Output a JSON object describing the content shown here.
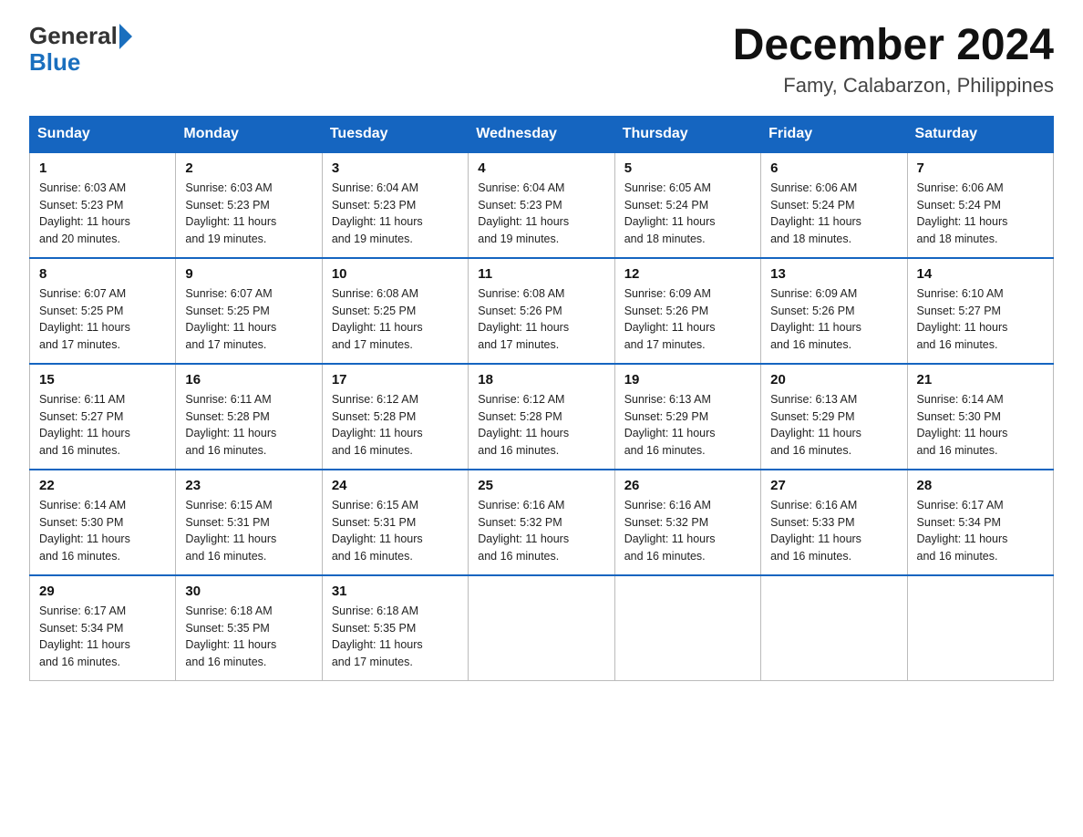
{
  "header": {
    "month": "December 2024",
    "location": "Famy, Calabarzon, Philippines",
    "logo_general": "General",
    "logo_blue": "Blue"
  },
  "weekdays": [
    "Sunday",
    "Monday",
    "Tuesday",
    "Wednesday",
    "Thursday",
    "Friday",
    "Saturday"
  ],
  "weeks": [
    {
      "days": [
        {
          "num": "1",
          "sunrise": "6:03 AM",
          "sunset": "5:23 PM",
          "daylight": "11 hours and 20 minutes."
        },
        {
          "num": "2",
          "sunrise": "6:03 AM",
          "sunset": "5:23 PM",
          "daylight": "11 hours and 19 minutes."
        },
        {
          "num": "3",
          "sunrise": "6:04 AM",
          "sunset": "5:23 PM",
          "daylight": "11 hours and 19 minutes."
        },
        {
          "num": "4",
          "sunrise": "6:04 AM",
          "sunset": "5:23 PM",
          "daylight": "11 hours and 19 minutes."
        },
        {
          "num": "5",
          "sunrise": "6:05 AM",
          "sunset": "5:24 PM",
          "daylight": "11 hours and 18 minutes."
        },
        {
          "num": "6",
          "sunrise": "6:06 AM",
          "sunset": "5:24 PM",
          "daylight": "11 hours and 18 minutes."
        },
        {
          "num": "7",
          "sunrise": "6:06 AM",
          "sunset": "5:24 PM",
          "daylight": "11 hours and 18 minutes."
        }
      ]
    },
    {
      "days": [
        {
          "num": "8",
          "sunrise": "6:07 AM",
          "sunset": "5:25 PM",
          "daylight": "11 hours and 17 minutes."
        },
        {
          "num": "9",
          "sunrise": "6:07 AM",
          "sunset": "5:25 PM",
          "daylight": "11 hours and 17 minutes."
        },
        {
          "num": "10",
          "sunrise": "6:08 AM",
          "sunset": "5:25 PM",
          "daylight": "11 hours and 17 minutes."
        },
        {
          "num": "11",
          "sunrise": "6:08 AM",
          "sunset": "5:26 PM",
          "daylight": "11 hours and 17 minutes."
        },
        {
          "num": "12",
          "sunrise": "6:09 AM",
          "sunset": "5:26 PM",
          "daylight": "11 hours and 17 minutes."
        },
        {
          "num": "13",
          "sunrise": "6:09 AM",
          "sunset": "5:26 PM",
          "daylight": "11 hours and 16 minutes."
        },
        {
          "num": "14",
          "sunrise": "6:10 AM",
          "sunset": "5:27 PM",
          "daylight": "11 hours and 16 minutes."
        }
      ]
    },
    {
      "days": [
        {
          "num": "15",
          "sunrise": "6:11 AM",
          "sunset": "5:27 PM",
          "daylight": "11 hours and 16 minutes."
        },
        {
          "num": "16",
          "sunrise": "6:11 AM",
          "sunset": "5:28 PM",
          "daylight": "11 hours and 16 minutes."
        },
        {
          "num": "17",
          "sunrise": "6:12 AM",
          "sunset": "5:28 PM",
          "daylight": "11 hours and 16 minutes."
        },
        {
          "num": "18",
          "sunrise": "6:12 AM",
          "sunset": "5:28 PM",
          "daylight": "11 hours and 16 minutes."
        },
        {
          "num": "19",
          "sunrise": "6:13 AM",
          "sunset": "5:29 PM",
          "daylight": "11 hours and 16 minutes."
        },
        {
          "num": "20",
          "sunrise": "6:13 AM",
          "sunset": "5:29 PM",
          "daylight": "11 hours and 16 minutes."
        },
        {
          "num": "21",
          "sunrise": "6:14 AM",
          "sunset": "5:30 PM",
          "daylight": "11 hours and 16 minutes."
        }
      ]
    },
    {
      "days": [
        {
          "num": "22",
          "sunrise": "6:14 AM",
          "sunset": "5:30 PM",
          "daylight": "11 hours and 16 minutes."
        },
        {
          "num": "23",
          "sunrise": "6:15 AM",
          "sunset": "5:31 PM",
          "daylight": "11 hours and 16 minutes."
        },
        {
          "num": "24",
          "sunrise": "6:15 AM",
          "sunset": "5:31 PM",
          "daylight": "11 hours and 16 minutes."
        },
        {
          "num": "25",
          "sunrise": "6:16 AM",
          "sunset": "5:32 PM",
          "daylight": "11 hours and 16 minutes."
        },
        {
          "num": "26",
          "sunrise": "6:16 AM",
          "sunset": "5:32 PM",
          "daylight": "11 hours and 16 minutes."
        },
        {
          "num": "27",
          "sunrise": "6:16 AM",
          "sunset": "5:33 PM",
          "daylight": "11 hours and 16 minutes."
        },
        {
          "num": "28",
          "sunrise": "6:17 AM",
          "sunset": "5:34 PM",
          "daylight": "11 hours and 16 minutes."
        }
      ]
    },
    {
      "days": [
        {
          "num": "29",
          "sunrise": "6:17 AM",
          "sunset": "5:34 PM",
          "daylight": "11 hours and 16 minutes."
        },
        {
          "num": "30",
          "sunrise": "6:18 AM",
          "sunset": "5:35 PM",
          "daylight": "11 hours and 16 minutes."
        },
        {
          "num": "31",
          "sunrise": "6:18 AM",
          "sunset": "5:35 PM",
          "daylight": "11 hours and 17 minutes."
        },
        null,
        null,
        null,
        null
      ]
    }
  ],
  "labels": {
    "sunrise": "Sunrise:",
    "sunset": "Sunset:",
    "daylight": "Daylight:"
  }
}
